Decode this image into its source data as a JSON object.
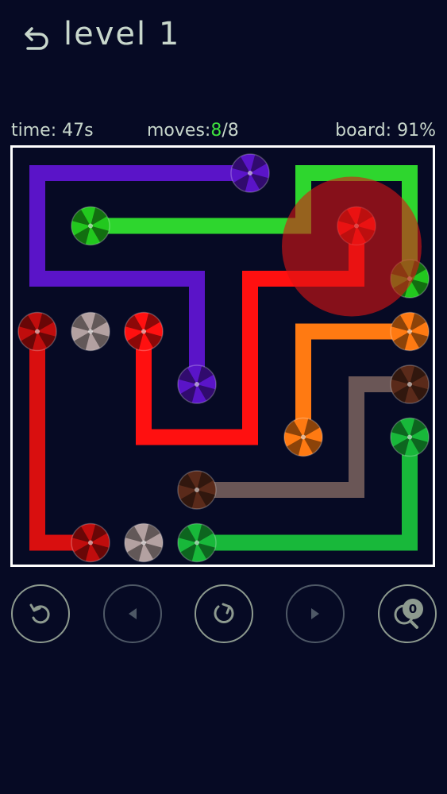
{
  "header": {
    "title": "level 1",
    "back_icon": "undo-arrow-icon"
  },
  "stats": {
    "time_label": "time:",
    "time_value": "47s",
    "moves_label": "moves:",
    "moves_current": "8",
    "moves_total": "/8",
    "board_label": "board:",
    "board_value": "91%"
  },
  "controls": {
    "undo_icon": "undo-icon",
    "prev_icon": "previous-level-icon",
    "restart_icon": "restart-icon",
    "next_icon": "next-level-icon",
    "hint_icon": "hint-magnifier-icon",
    "hint_count": "0"
  },
  "colors": {
    "background": "#060a24",
    "purple": "#5a14c8",
    "green": "#2ed62e",
    "red": "#ff1010",
    "darkred": "#d90f0f",
    "orange": "#ff7a12",
    "brown": "#6a5656",
    "darkgreen": "#18b83a"
  },
  "flows": [
    {
      "color": "purple",
      "cells": [
        [
          4,
          0
        ],
        [
          3,
          0
        ],
        [
          2,
          0
        ],
        [
          1,
          0
        ],
        [
          0,
          0
        ],
        [
          0,
          1
        ],
        [
          0,
          2
        ],
        [
          1,
          2
        ],
        [
          2,
          2
        ],
        [
          3,
          2
        ],
        [
          3,
          3
        ],
        [
          3,
          4
        ]
      ]
    },
    {
      "color": "green",
      "cells": [
        [
          1,
          1
        ],
        [
          2,
          1
        ],
        [
          3,
          1
        ],
        [
          4,
          1
        ],
        [
          5,
          1
        ],
        [
          5,
          0
        ],
        [
          6,
          0
        ],
        [
          7,
          0
        ],
        [
          7,
          1
        ],
        [
          7,
          2
        ]
      ]
    },
    {
      "color": "red",
      "cells": [
        [
          6,
          1
        ],
        [
          6,
          2
        ],
        [
          5,
          2
        ],
        [
          4,
          2
        ],
        [
          4,
          3
        ],
        [
          4,
          4
        ],
        [
          4,
          5
        ],
        [
          3,
          5
        ],
        [
          2,
          5
        ],
        [
          2,
          4
        ],
        [
          2,
          3
        ]
      ]
    },
    {
      "color": "darkred",
      "cells": [
        [
          0,
          3
        ],
        [
          0,
          4
        ],
        [
          0,
          5
        ],
        [
          0,
          6
        ],
        [
          0,
          7
        ],
        [
          1,
          7
        ]
      ]
    },
    {
      "color": "orange",
      "cells": [
        [
          7,
          3
        ],
        [
          6,
          3
        ],
        [
          5,
          3
        ],
        [
          5,
          4
        ],
        [
          5,
          5
        ]
      ]
    },
    {
      "color": "brown",
      "cells": [
        [
          7,
          4
        ],
        [
          6,
          4
        ],
        [
          6,
          5
        ],
        [
          6,
          6
        ],
        [
          5,
          6
        ],
        [
          4,
          6
        ],
        [
          3,
          6
        ]
      ]
    },
    {
      "color": "darkgreen",
      "cells": [
        [
          7,
          5
        ],
        [
          7,
          6
        ],
        [
          7,
          7
        ],
        [
          6,
          7
        ],
        [
          5,
          7
        ],
        [
          4,
          7
        ],
        [
          3,
          7
        ]
      ]
    }
  ],
  "endpoints": [
    {
      "cell": [
        4,
        0
      ],
      "color": "#5a14c8"
    },
    {
      "cell": [
        3,
        4
      ],
      "color": "#5a14c8"
    },
    {
      "cell": [
        1,
        1
      ],
      "color": "#22c81e"
    },
    {
      "cell": [
        7,
        2
      ],
      "color": "#22c81e"
    },
    {
      "cell": [
        6,
        1
      ],
      "color": "#ff1010"
    },
    {
      "cell": [
        2,
        3
      ],
      "color": "#ff1010"
    },
    {
      "cell": [
        0,
        3
      ],
      "color": "#c00d0d"
    },
    {
      "cell": [
        1,
        7
      ],
      "color": "#c00d0d"
    },
    {
      "cell": [
        1,
        3
      ],
      "color": "#b3a1a1"
    },
    {
      "cell": [
        2,
        7
      ],
      "color": "#b3a1a1"
    },
    {
      "cell": [
        7,
        3
      ],
      "color": "#ff7a12"
    },
    {
      "cell": [
        5,
        5
      ],
      "color": "#ff7a12"
    },
    {
      "cell": [
        7,
        4
      ],
      "color": "#5a2a1a"
    },
    {
      "cell": [
        3,
        6
      ],
      "color": "#5a2a1a"
    },
    {
      "cell": [
        7,
        5
      ],
      "color": "#18b83a"
    },
    {
      "cell": [
        3,
        7
      ],
      "color": "#18b83a"
    }
  ],
  "touch_indicator": {
    "cell": [
      6,
      1
    ]
  }
}
